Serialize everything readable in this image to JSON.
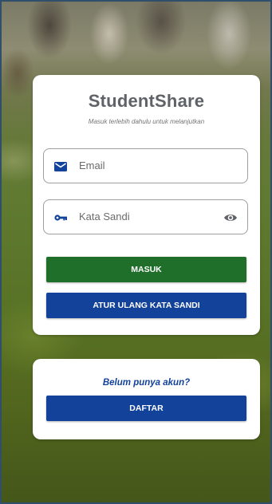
{
  "app": {
    "title": "StudentShare",
    "subtitle": "Masuk terlebih dahulu untuk melanjutkan"
  },
  "form": {
    "email_placeholder": "Email",
    "email_icon": "envelope-icon",
    "password_placeholder": "Kata Sandi",
    "password_icon": "key-icon",
    "password_toggle_icon": "eye-icon"
  },
  "buttons": {
    "login_label": "MASUK",
    "reset_label": "ATUR ULANG KATA SANDI",
    "register_label": "DAFTAR"
  },
  "signup": {
    "prompt": "Belum punya akun?"
  },
  "colors": {
    "login_button": "#1f6f2a",
    "primary_blue": "#12429a",
    "title_gray": "#5f6368"
  }
}
